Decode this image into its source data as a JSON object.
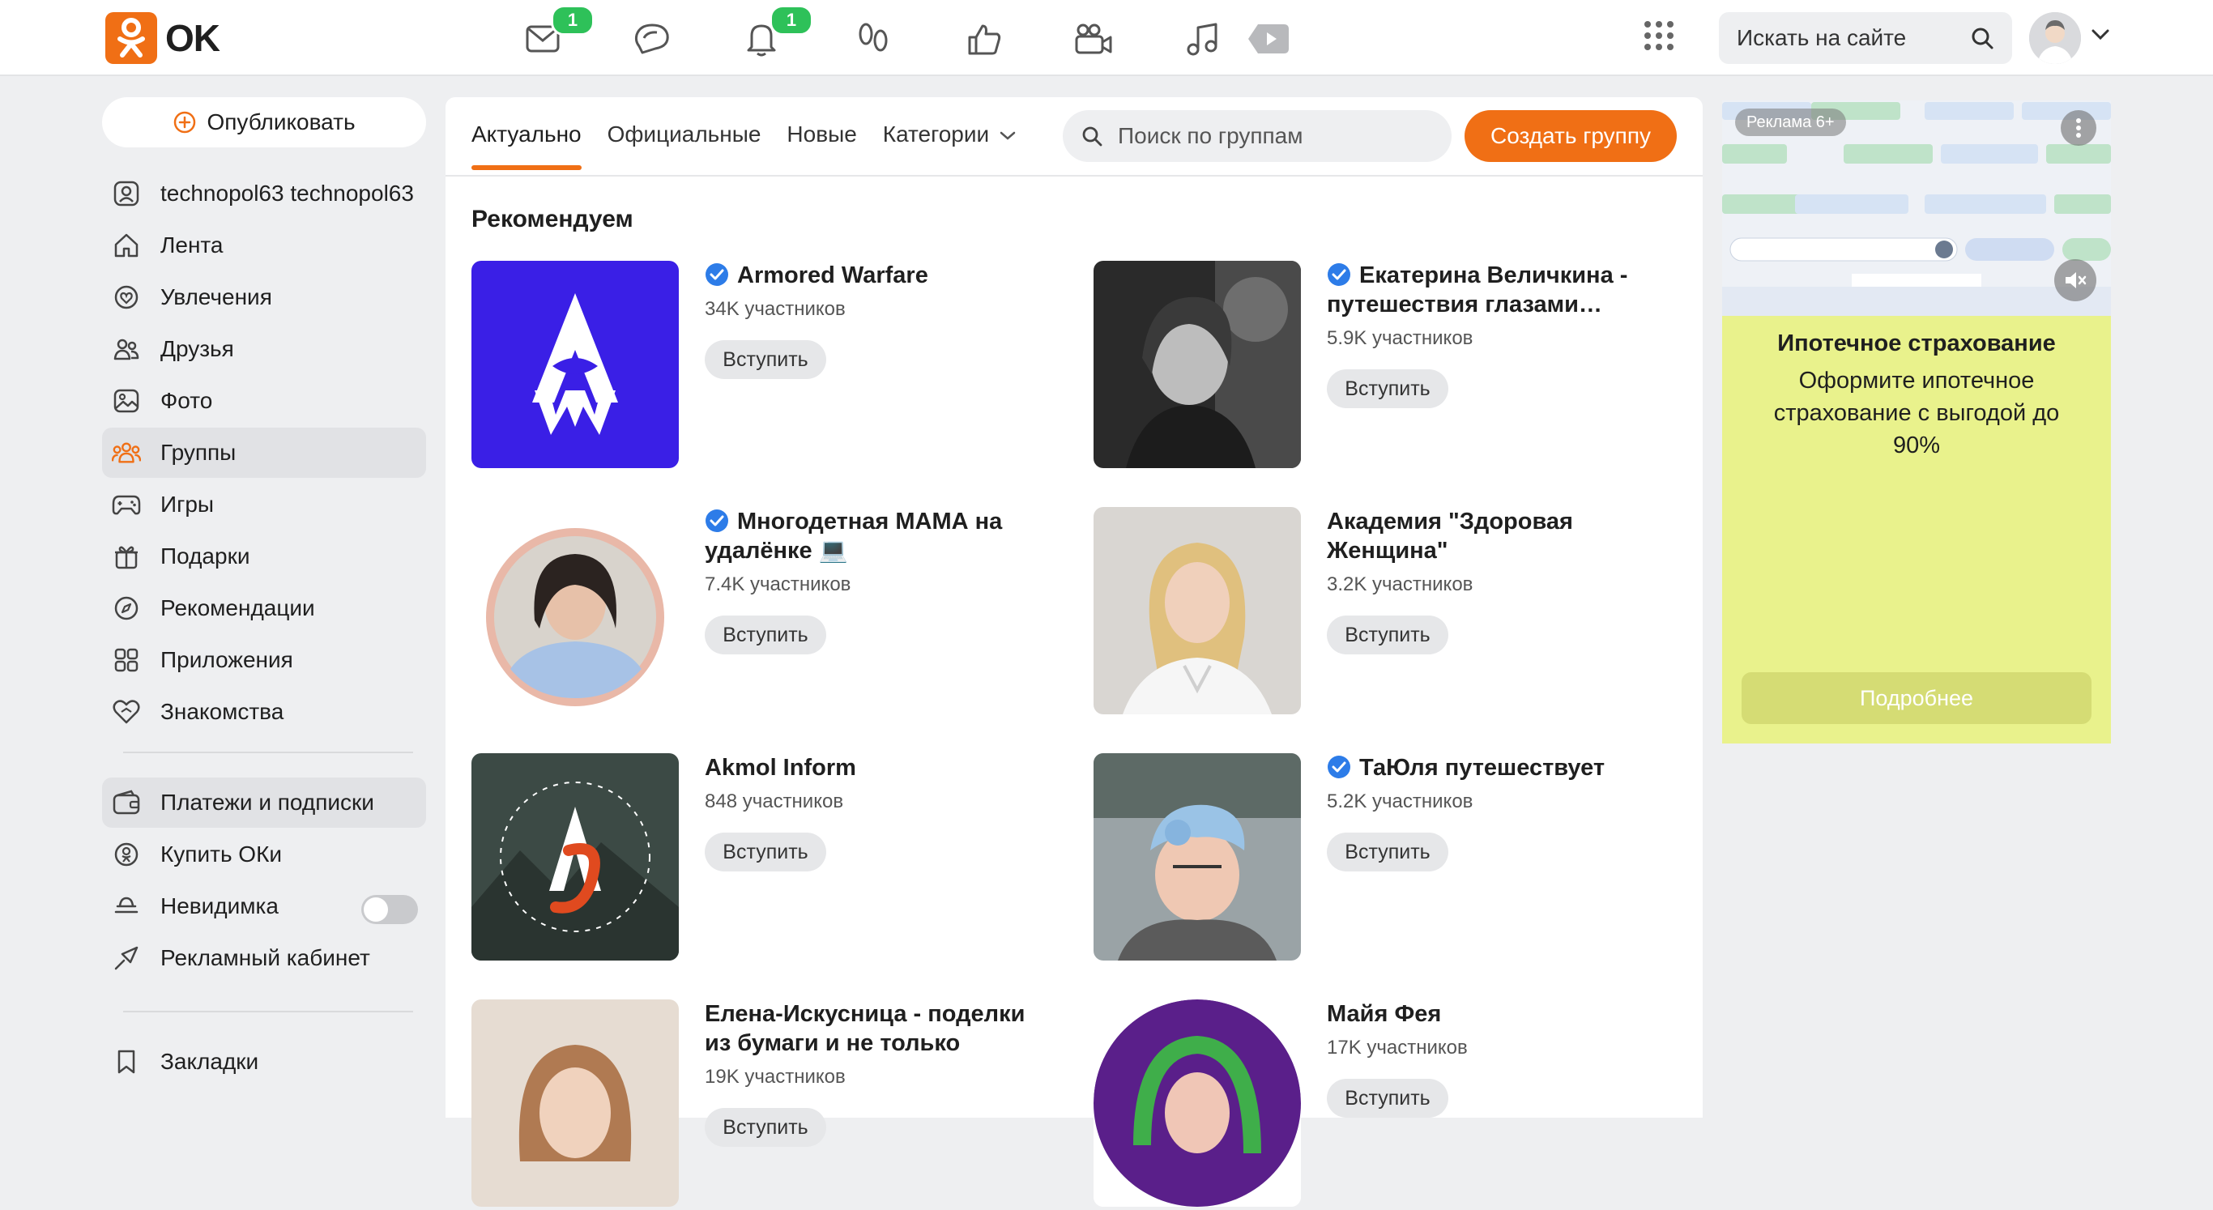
{
  "header": {
    "logo_text": "OK",
    "messages_badge": "1",
    "notifications_badge": "1",
    "search_placeholder": "Искать на сайте"
  },
  "sidebar": {
    "publish_label": "Опубликовать",
    "items": [
      {
        "label": "technopol63 technopol63",
        "icon": "profile-icon"
      },
      {
        "label": "Лента",
        "icon": "home-icon"
      },
      {
        "label": "Увлечения",
        "icon": "hobby-icon"
      },
      {
        "label": "Друзья",
        "icon": "friends-icon"
      },
      {
        "label": "Фото",
        "icon": "photo-icon"
      },
      {
        "label": "Группы",
        "icon": "groups-icon"
      },
      {
        "label": "Игры",
        "icon": "gamepad-icon"
      },
      {
        "label": "Подарки",
        "icon": "gift-icon"
      },
      {
        "label": "Рекомендации",
        "icon": "compass-icon"
      },
      {
        "label": "Приложения",
        "icon": "apps-icon"
      },
      {
        "label": "Знакомства",
        "icon": "dating-icon"
      }
    ],
    "items2": [
      {
        "label": "Платежи и подписки",
        "icon": "wallet-icon"
      },
      {
        "label": "Купить ОКи",
        "icon": "coin-icon"
      },
      {
        "label": "Невидимка",
        "icon": "invisible-icon"
      },
      {
        "label": "Рекламный кабинет",
        "icon": "ads-icon"
      }
    ],
    "bookmarks_label": "Закладки"
  },
  "main": {
    "tabs": [
      "Актуально",
      "Официальные",
      "Новые",
      "Категории"
    ],
    "search_placeholder": "Поиск по группам",
    "create_label": "Создать группу",
    "section_title": "Рекомендуем",
    "join_label": "Вступить",
    "groups": [
      {
        "name": "Armored Warfare",
        "members": "34K участников",
        "verified": true
      },
      {
        "name": "Екатерина Величкина - путешествия глазами…",
        "members": "5.9K участников",
        "verified": true
      },
      {
        "name": "Многодетная МАМА на удалёнке 💻",
        "members": "7.4K участников",
        "verified": true
      },
      {
        "name": "Академия \"Здоровая Женщина\"",
        "members": "3.2K участников",
        "verified": false
      },
      {
        "name": "Akmol Inform",
        "members": "848 участников",
        "verified": false
      },
      {
        "name": "ТаЮля путешествует",
        "members": "5.2K участников",
        "verified": true
      },
      {
        "name": "Елена-Искусница - поделки из бумаги и не только",
        "members": "19K участников",
        "verified": false
      },
      {
        "name": "Майя Фея",
        "members": "17K участников",
        "verified": false
      }
    ]
  },
  "ad": {
    "label": "Реклама 6+",
    "title": "Ипотечное страхование",
    "text": "Оформите ипотечное страхование с выгодой до 90%",
    "button": "Подробнее"
  },
  "colors": {
    "accent": "#f06f15",
    "badge": "#2ec159",
    "verified": "#2d7ce8",
    "ad_bg": "#e9f28c"
  }
}
